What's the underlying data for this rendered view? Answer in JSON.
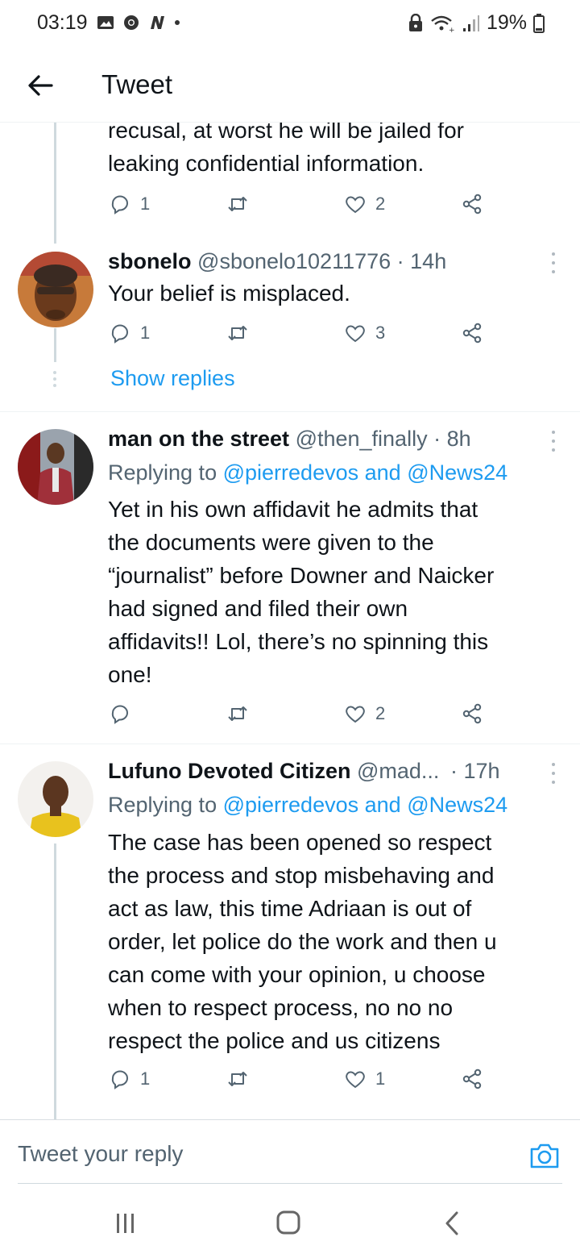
{
  "status_bar": {
    "time": "03:19",
    "battery": "19%"
  },
  "header": {
    "title": "Tweet"
  },
  "tweets": [
    {
      "text_lines": [
        "recusal, at worst he will be jailed for",
        "leaking confidential information."
      ],
      "replies": "1",
      "retweets": "",
      "likes": "2"
    },
    {
      "name": "sbonelo",
      "handle": "@sbonelo10211776",
      "time": "· 14h",
      "text": "Your belief is misplaced.",
      "replies": "1",
      "retweets": "",
      "likes": "3",
      "show_replies": "Show replies"
    },
    {
      "name": "man on the street",
      "handle": "@then_finally",
      "time": "· 8h",
      "replying_prefix": "Replying to",
      "mention_1": "@pierredevos",
      "and": "and",
      "mention_2": "@News24",
      "text_lines": [
        "Yet in his own affidavit he admits that",
        "the documents were given to the",
        "“journalist” before Downer and Naicker",
        "had signed and filed their own",
        "affidavits!! Lol, there’s no spinning this",
        "one!"
      ],
      "replies": "",
      "retweets": "",
      "likes": "2"
    },
    {
      "name": "Lufuno Devoted Citizen",
      "handle": "@mad...",
      "time": "· 17h",
      "replying_prefix": "Replying to",
      "mention_1": "@pierredevos",
      "and": "and",
      "mention_2": "@News24",
      "text_lines": [
        "The case has been opened so respect",
        "the process and stop misbehaving and",
        "act as law, this time Adriaan is out of",
        "order, let police do the work and then u",
        "can come with your opinion, u choose",
        "when to respect process, no no no",
        "respect the police and us citizens"
      ],
      "replies": "1",
      "retweets": "",
      "likes": "1"
    }
  ],
  "reply_bar": {
    "placeholder": "Tweet your reply"
  },
  "colors": {
    "link": "#1d9bf0",
    "muted": "#536471",
    "text": "#0f1419",
    "thread_line": "#cfd9de"
  }
}
